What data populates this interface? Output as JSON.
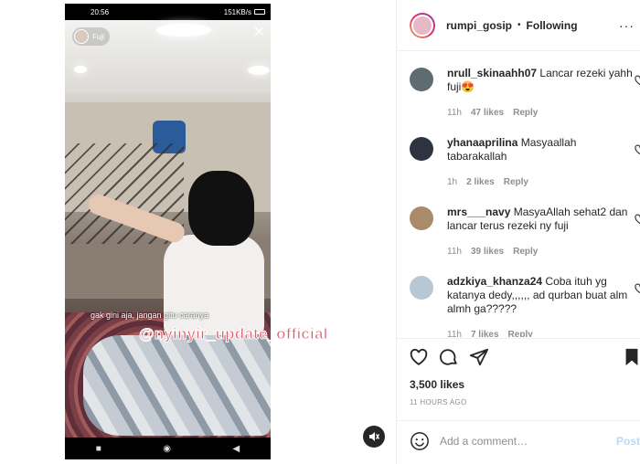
{
  "video": {
    "status_time": "20:56",
    "status_speed": "151KB/s",
    "live_user": "Fuji",
    "caption_line": "gak gini aja, jangan gitu caranya",
    "watermark": "@nyinyir_update_official",
    "nav_square": "■",
    "nav_home": "◉",
    "nav_back": "◀"
  },
  "header": {
    "username": "rumpi_gosip",
    "separator": "•",
    "follow_label": "Following",
    "more_label": "···"
  },
  "comments": [
    {
      "user": "nrull_skinaahh07",
      "text": "Lancar rezeki yahh fuji😍",
      "time": "11h",
      "likes": "47 likes",
      "reply": "Reply",
      "avatar_color": "#5f6b73"
    },
    {
      "user": "yhanaaprilina",
      "text": "Masyaallah tabarakallah",
      "time": "1h",
      "likes": "2 likes",
      "reply": "Reply",
      "avatar_color": "#2d3440"
    },
    {
      "user": "mrs___navy",
      "text": "MasyaAllah sehat2 dan lancar terus rezeki ny fuji",
      "time": "11h",
      "likes": "39 likes",
      "reply": "Reply",
      "avatar_color": "#a98a69"
    },
    {
      "user": "adzkiya_khanza24",
      "text": "Coba ituh yg katanya dedy,,,,,, ad qurban buat alm almh ga?????",
      "time": "11h",
      "likes": "7 likes",
      "reply": "Reply",
      "avatar_color": "#b8c7d6"
    }
  ],
  "stats": {
    "likes": "3,500 likes",
    "time_ago": "11 HOURS AGO"
  },
  "composer": {
    "placeholder": "Add a comment…",
    "post_label": "Post"
  },
  "colors": {
    "watermark": "#e05a6c",
    "post_button": "#b3dbff",
    "meta_gray": "#8e8e8e"
  }
}
